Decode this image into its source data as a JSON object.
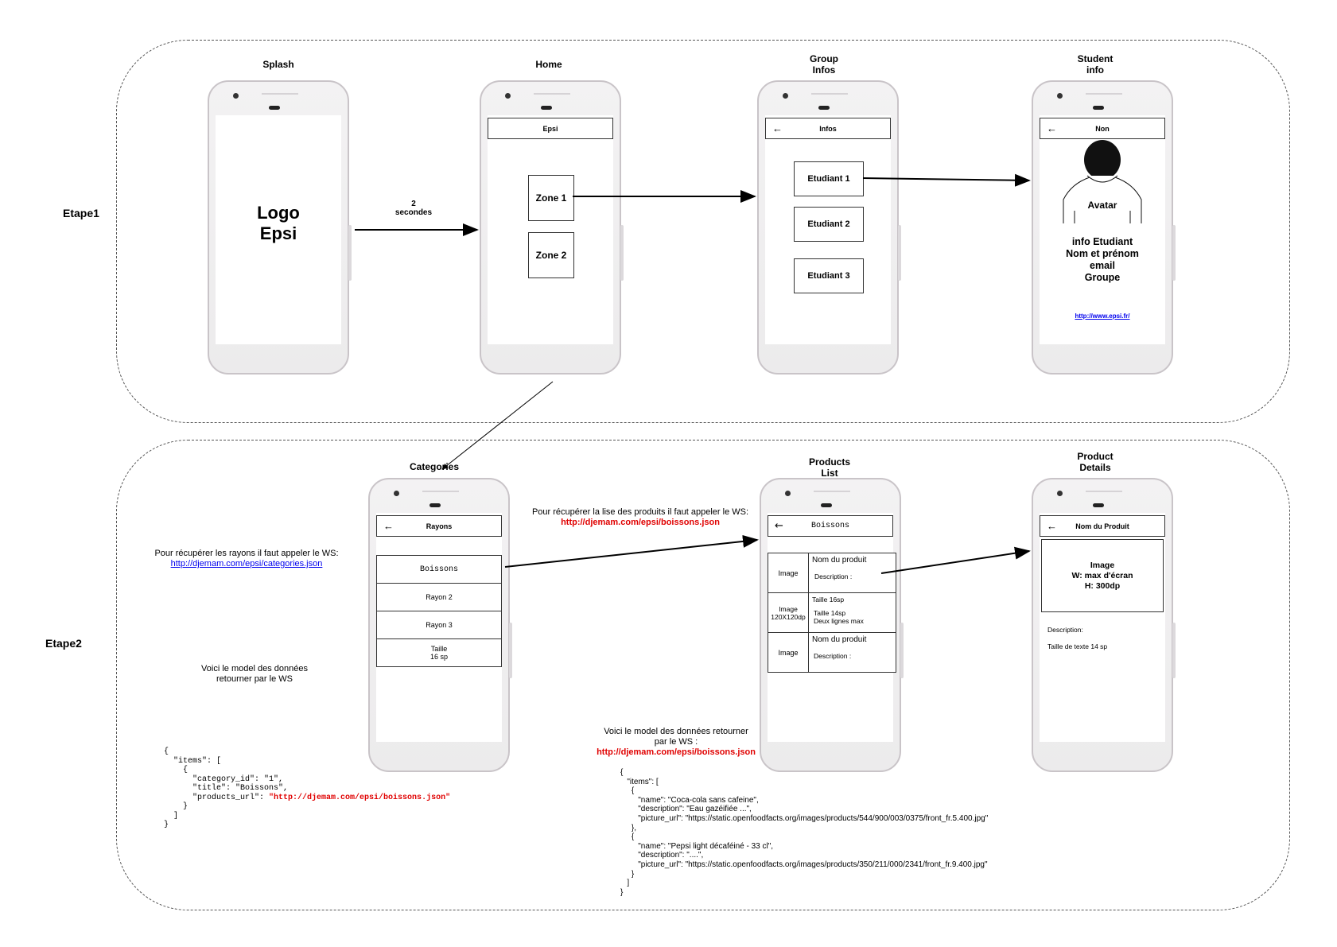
{
  "stages": [
    {
      "label": "Etape1"
    },
    {
      "label": "Etape2"
    }
  ],
  "screens": {
    "splash": {
      "caption": "Splash",
      "logo": "Logo\nEpsi"
    },
    "home": {
      "caption": "Home",
      "appbar": "Epsi",
      "zones": [
        "Zone 1",
        "Zone 2"
      ]
    },
    "group": {
      "caption": "Group\nInfos",
      "appbar": "Infos",
      "students": [
        "Etudiant 1",
        "Etudiant 2",
        "Etudiant 3"
      ]
    },
    "student": {
      "caption": "Student\ninfo",
      "appbar": "Non",
      "avatar": "Avatar",
      "info": "info Etudiant\nNom et prénom\nemail\nGroupe",
      "link": "http://www.epsi.fr/"
    },
    "categories": {
      "caption": "Categories",
      "appbar": "Rayons",
      "rows": [
        "Boissons",
        "Rayon 2",
        "Rayon 3",
        "Taille\n16 sp"
      ]
    },
    "products": {
      "caption": "Products\nList",
      "appbar": "Boissons",
      "items": [
        {
          "image": "Image",
          "title": "Nom du produit",
          "desc": "Description :"
        },
        {
          "image": "Image\n120X120dp",
          "title": "Taille 16sp",
          "desc": "Taille 14sp\nDeux lignes max"
        },
        {
          "image": "Image",
          "title": "Nom du produit",
          "desc": "Description :"
        }
      ]
    },
    "details": {
      "caption": "Product\nDetails",
      "appbar": "Nom du Produit",
      "image": "Image\nW: max d'écran\nH: 300dp",
      "desc": "Description:",
      "size": "Taille de texte 14 sp"
    }
  },
  "transitions": {
    "splash_home": "2\nsecondes"
  },
  "notes": {
    "rayons_intro": "Pour récupérer les rayons il faut appeler le WS:",
    "rayons_url": "http://djemam.com/epsi/categories.json",
    "produits_intro": "Pour récupérer la lise des produits il faut appeler le WS:",
    "produits_url": "http://djemam.com/epsi/boissons.json",
    "model_categories": "Voici le model des données\nretourner par le WS",
    "model_products_intro": "Voici le model des données retourner\npar le WS :",
    "model_products_url": "http://djemam.com/epsi/boissons.json"
  },
  "code": {
    "categories_prefix": "{\n  \"items\": [\n    {\n      \"category_id\": \"1\",\n      \"title\": \"Boissons\",\n      \"products_url\": ",
    "categories_url": "\"http://djemam.com/epsi/boissons.json\"",
    "categories_suffix": "\n    }\n  ]\n}",
    "products": "{\n   \"items\": [\n     {\n        \"name\": \"Coca-cola sans cafeine\",\n        \"description\": \"Eau gazéifiée ...\",\n        \"picture_url\": \"https://static.openfoodfacts.org/images/products/544/900/003/0375/front_fr.5.400.jpg\"\n     },\n     {\n        \"name\": \"Pepsi light décaféiné - 33 cl\",\n        \"description\": \"....\",\n        \"picture_url\": \"https://static.openfoodfacts.org/images/products/350/211/000/2341/front_fr.9.400.jpg\"\n     }\n   ]\n}"
  }
}
